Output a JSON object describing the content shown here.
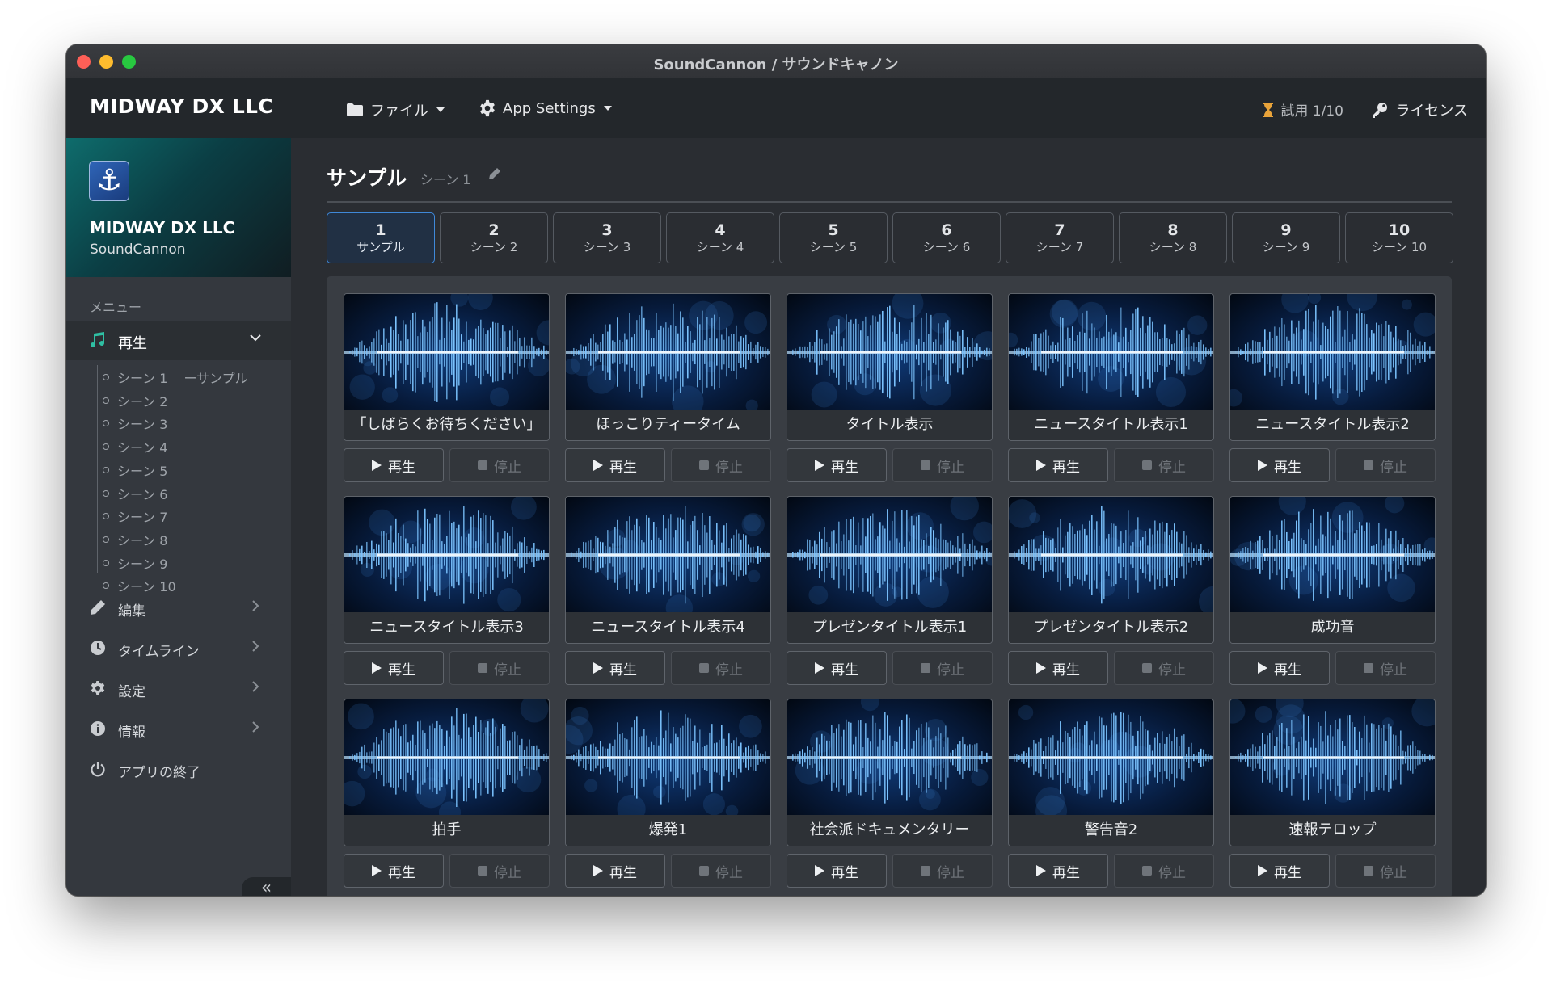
{
  "window": {
    "title": "SoundCannon / サウンドキャノン"
  },
  "navbar": {
    "brand": "MIDWAY DX LLC",
    "file_menu": "ファイル",
    "settings_menu": "App Settings",
    "trial": "試用 1/10",
    "license": "ライセンス"
  },
  "sidebar": {
    "company": "MIDWAY DX LLC",
    "app": "SoundCannon",
    "menu_heading": "メニュー",
    "play_label": "再生",
    "scenes": [
      {
        "label": "シーン 1",
        "suffix": "ーサンプル"
      },
      {
        "label": "シーン 2",
        "suffix": ""
      },
      {
        "label": "シーン 3",
        "suffix": ""
      },
      {
        "label": "シーン 4",
        "suffix": ""
      },
      {
        "label": "シーン 5",
        "suffix": ""
      },
      {
        "label": "シーン 6",
        "suffix": ""
      },
      {
        "label": "シーン 7",
        "suffix": ""
      },
      {
        "label": "シーン 8",
        "suffix": ""
      },
      {
        "label": "シーン 9",
        "suffix": ""
      },
      {
        "label": "シーン 10",
        "suffix": ""
      }
    ],
    "items": [
      {
        "label": "編集",
        "icon": "pencil-icon"
      },
      {
        "label": "タイムライン",
        "icon": "clock-icon"
      },
      {
        "label": "設定",
        "icon": "gear-icon"
      },
      {
        "label": "情報",
        "icon": "info-icon"
      },
      {
        "label": "アプリの終了",
        "icon": "power-icon"
      }
    ],
    "collapse": "«"
  },
  "main": {
    "title": "サンプル",
    "subtitle": "シーン 1",
    "tabs": [
      {
        "num": "1",
        "label": "サンプル",
        "active": true
      },
      {
        "num": "2",
        "label": "シーン 2"
      },
      {
        "num": "3",
        "label": "シーン 3"
      },
      {
        "num": "4",
        "label": "シーン 4"
      },
      {
        "num": "5",
        "label": "シーン 5"
      },
      {
        "num": "6",
        "label": "シーン 6"
      },
      {
        "num": "7",
        "label": "シーン 7"
      },
      {
        "num": "8",
        "label": "シーン 8"
      },
      {
        "num": "9",
        "label": "シーン 9"
      },
      {
        "num": "10",
        "label": "シーン 10"
      }
    ],
    "play_label": "再生",
    "stop_label": "停止",
    "sounds": [
      "「しばらくお待ちください」",
      "ほっこりティータイム",
      "タイトル表示",
      "ニュースタイトル表示1",
      "ニュースタイトル表示2",
      "ニュースタイトル表示3",
      "ニュースタイトル表示4",
      "プレゼンタイトル表示1",
      "プレゼンタイトル表示2",
      "成功音",
      "拍手",
      "爆発1",
      "社会派ドキュメンタリー",
      "警告音2",
      "速報テロップ"
    ]
  },
  "colors": {
    "accent": "#3f88d8",
    "music_icon": "#2fbfa3",
    "trial_icon": "#e8a33a"
  }
}
